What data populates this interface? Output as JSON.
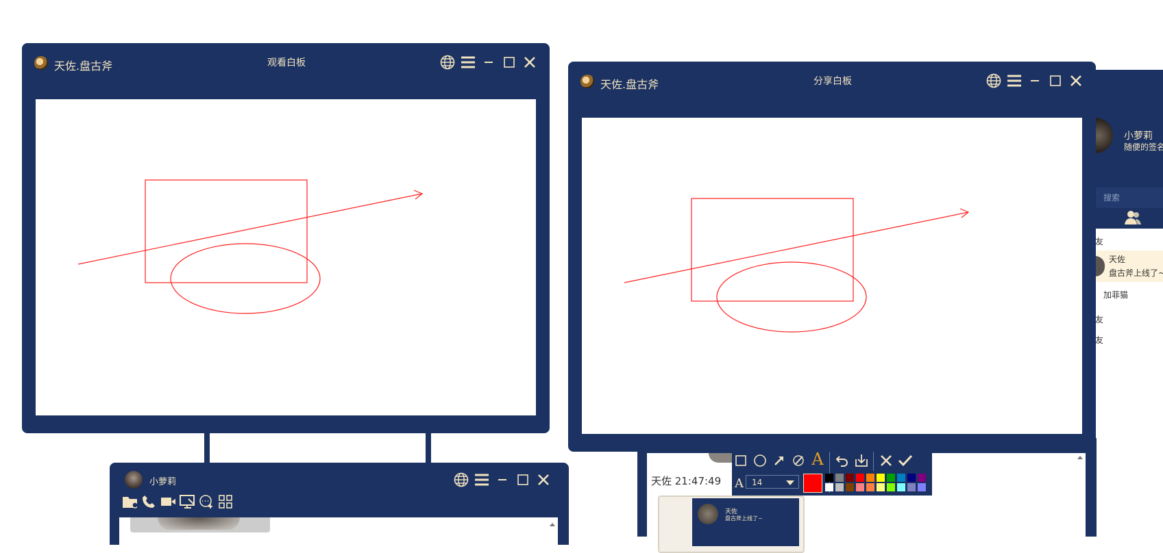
{
  "colors": {
    "frame": "#1b3262",
    "title_text": "#f3e3c0",
    "drawing": "#ff2020",
    "canvas": "#ffffff"
  },
  "viewer_window": {
    "app_name": "天佐.盘古斧",
    "title": "观看白板",
    "controls": [
      "globe-icon",
      "menu-icon",
      "minimize-icon",
      "maximize-icon",
      "close-icon"
    ]
  },
  "share_window": {
    "app_name": "天佐.盘古斧",
    "title": "分享白板",
    "controls": [
      "globe-icon",
      "menu-icon",
      "minimize-icon",
      "maximize-icon",
      "close-icon"
    ]
  },
  "main_panel": {
    "user_name": "小萝莉",
    "signature": "随便的签名",
    "search_placeholder": "搜索",
    "contacts_tab_icon": "contacts-icon",
    "list": [
      {
        "text": "友"
      },
      {
        "name": "天佐",
        "message": "盘古斧上线了~"
      },
      {
        "text": "加菲猫"
      },
      {
        "text": "友"
      },
      {
        "text": "友"
      }
    ]
  },
  "chat_window": {
    "contact_name": "小萝莉",
    "toolbar_icons": [
      "folder-icon",
      "phone-icon",
      "video-icon",
      "screen-share-icon",
      "chat-add-icon",
      "apps-icon"
    ]
  },
  "right_chat": {
    "timestamp": "天佐 21:47:49",
    "mini_card": {
      "name": "天佐",
      "message": "盘古斧上线了~"
    }
  },
  "draw_toolbar": {
    "tools": [
      "rectangle-icon",
      "ellipse-icon",
      "arrow-icon",
      "brush-icon",
      "text-icon",
      "undo-icon",
      "save-icon",
      "cancel-icon",
      "confirm-icon"
    ],
    "font_label": "A",
    "font_size": "14",
    "current_color": "#ff0000",
    "palette": [
      "#000000",
      "#808080",
      "#800000",
      "#ff0000",
      "#ff8000",
      "#ffff00",
      "#00a000",
      "#0080c0",
      "#000080",
      "#800080",
      "#ffffff",
      "#c0c0c0",
      "#804000",
      "#ff8080",
      "#ff8040",
      "#ffff80",
      "#80ff00",
      "#80ffff",
      "#8080c0",
      "#8080ff"
    ]
  }
}
